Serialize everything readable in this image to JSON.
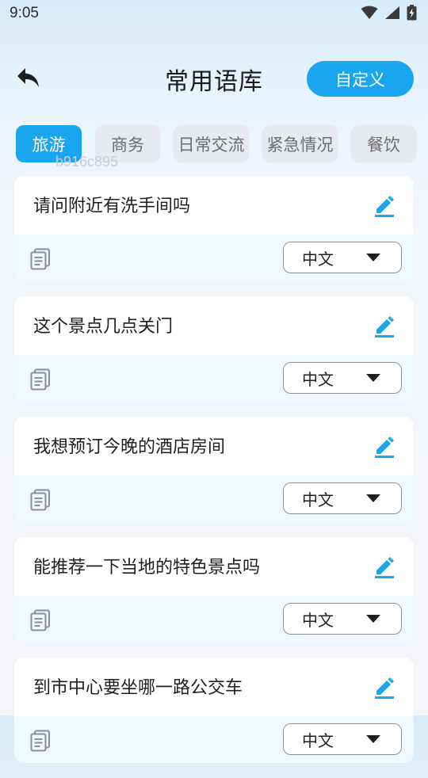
{
  "status": {
    "time": "9:05"
  },
  "header": {
    "title": "常用语库",
    "custom_label": "自定义"
  },
  "tabs": [
    {
      "label": "旅游",
      "active": true
    },
    {
      "label": "商务",
      "active": false
    },
    {
      "label": "日常交流",
      "active": false
    },
    {
      "label": "紧急情况",
      "active": false
    },
    {
      "label": "餐饮",
      "active": false
    }
  ],
  "watermark": "b916c895",
  "phrases": [
    {
      "text": "请问附近有洗手间吗",
      "language": "中文"
    },
    {
      "text": "这个景点几点关门",
      "language": "中文"
    },
    {
      "text": "我想预订今晚的酒店房间",
      "language": "中文"
    },
    {
      "text": "能推荐一下当地的特色景点吗",
      "language": "中文"
    },
    {
      "text": "到市中心要坐哪一路公交车",
      "language": "中文"
    }
  ],
  "colors": {
    "accent": "#1aa6ef",
    "tab_inactive": "#e7ebef",
    "card_footer": "#eef8fd"
  },
  "icons": {
    "back": "back-arrow-icon",
    "edit": "pencil-edit-icon",
    "copy": "copy-document-icon",
    "dropdown": "caret-down-icon"
  }
}
